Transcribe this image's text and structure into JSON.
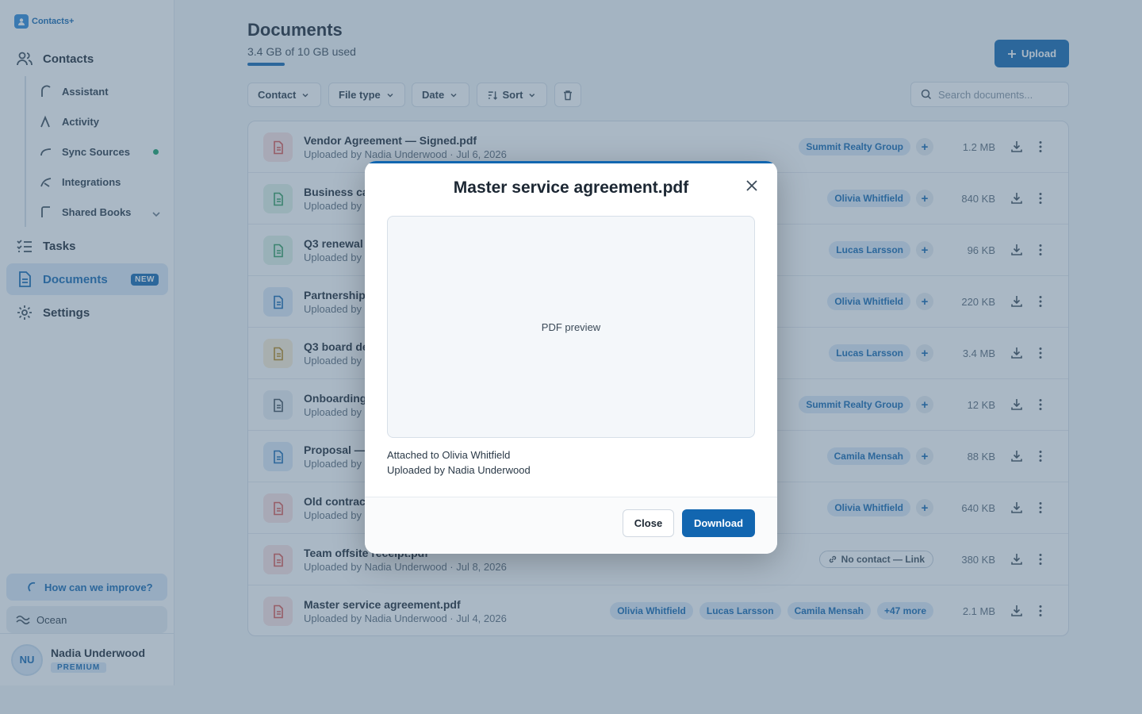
{
  "app": {
    "name": "Contacts+"
  },
  "sidebar": {
    "contacts_label": "Contacts",
    "sub_items": [
      {
        "label": "Assistant"
      },
      {
        "label": "Activity"
      },
      {
        "label": "Sync Sources"
      },
      {
        "label": "Integrations"
      },
      {
        "label": "Shared Books"
      }
    ],
    "tasks_label": "Tasks",
    "documents_label": "Documents",
    "documents_badge": "NEW",
    "settings_label": "Settings",
    "feedback_label": "How can we improve?",
    "theme_label": "Ocean",
    "user": {
      "initials": "NU",
      "name": "Nadia Underwood",
      "plan": "PREMIUM"
    }
  },
  "main": {
    "title": "Documents",
    "storage_text": "3.4 GB of 10 GB used",
    "storage_fraction": 0.34,
    "upload_label": "Upload",
    "filters": {
      "contact": "Contact",
      "file_type": "File type",
      "date": "Date",
      "sort": "Sort"
    },
    "search_placeholder": "Search documents...",
    "rows": [
      {
        "name": "Vendor Agreement — Signed.pdf",
        "meta": "Uploaded by Nadia Underwood · Jul 6, 2026",
        "tags": [
          "Summit Realty Group"
        ],
        "size": "1.2 MB",
        "icon": "pdf-icon"
      },
      {
        "name": "Business ca",
        "meta": "Uploaded by N",
        "tags": [
          "Olivia Whitfield"
        ],
        "size": "840 KB",
        "icon": "image-icon"
      },
      {
        "name": "Q3 renewal",
        "meta": "Uploaded by N",
        "tags": [
          "Lucas Larsson"
        ],
        "size": "96 KB",
        "icon": "spreadsheet-icon"
      },
      {
        "name": "Partnership",
        "meta": "Uploaded by N",
        "tags": [
          "Olivia Whitfield"
        ],
        "size": "220 KB",
        "icon": "doc-icon"
      },
      {
        "name": "Q3 board de",
        "meta": "Uploaded by N",
        "tags": [
          "Lucas Larsson"
        ],
        "size": "3.4 MB",
        "icon": "chart-file-icon"
      },
      {
        "name": "Onboarding",
        "meta": "Uploaded by N",
        "tags": [
          "Summit Realty Group"
        ],
        "size": "12 KB",
        "icon": "text-file-icon"
      },
      {
        "name": "Proposal —",
        "meta": "Uploaded by N",
        "tags": [
          "Camila Mensah"
        ],
        "size": "88 KB",
        "icon": "doc-icon"
      },
      {
        "name": "Old contrac",
        "meta": "Uploaded by N",
        "tags": [
          "Olivia Whitfield"
        ],
        "size": "640 KB",
        "icon": "pdf-icon"
      },
      {
        "name": "Team offsite receipt.pdf",
        "meta": "Uploaded by Nadia Underwood · Jul 8, 2026",
        "tags": [],
        "link_label": "No contact — Link",
        "size": "380 KB",
        "icon": "pdf-icon"
      },
      {
        "name": "Master service agreement.pdf",
        "meta": "Uploaded by Nadia Underwood · Jul 4, 2026",
        "tags": [
          "Olivia Whitfield",
          "Lucas Larsson",
          "Camila Mensah",
          "+47 more"
        ],
        "size": "2.1 MB",
        "icon": "pdf-icon"
      }
    ]
  },
  "modal": {
    "title": "Master service agreement.pdf",
    "preview_label": "PDF preview",
    "attached_text": "Attached to Olivia Whitfield",
    "uploaded_text": "Uploaded by Nadia Underwood",
    "close_label": "Close",
    "download_label": "Download"
  },
  "colors": {
    "accent": "#1266b0",
    "online": "#18a06b",
    "pdf": "#d9534f"
  }
}
